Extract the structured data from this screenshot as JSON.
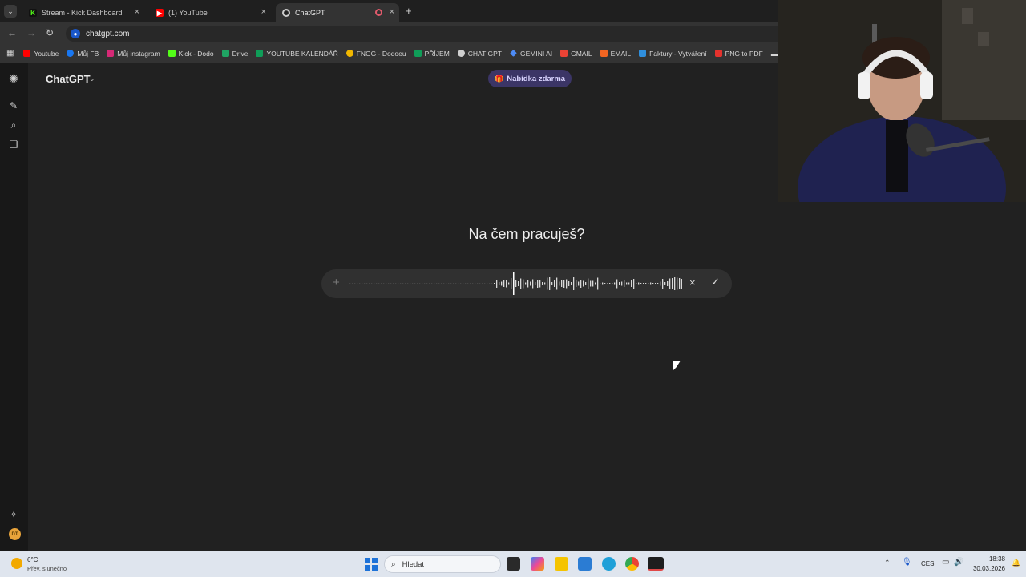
{
  "browser": {
    "tabs": [
      {
        "title": "Stream - Kick Dashboard",
        "favicon": "kick-icon",
        "active": false
      },
      {
        "title": "(1) YouTube",
        "favicon": "youtube-icon",
        "active": false
      },
      {
        "title": "ChatGPT",
        "favicon": "chatgpt-icon",
        "active": true
      }
    ],
    "new_tab": "+",
    "close_glyph": "×",
    "url": "chatgpt.com",
    "bookmarks": [
      {
        "label": "Youtube",
        "color": "#ff0000"
      },
      {
        "label": "Můj FB",
        "color": "#1877f2"
      },
      {
        "label": "Můj instagram",
        "color": "#d62976"
      },
      {
        "label": "Kick - Dodo",
        "color": "#53fc18"
      },
      {
        "label": "Drive",
        "color": "#1fa463"
      },
      {
        "label": "YOUTUBE KALENDÁŘ",
        "color": "#0f9d58"
      },
      {
        "label": "FNGG - Dodoeu",
        "color": "#f2b800"
      },
      {
        "label": "PŘÍJEM",
        "color": "#0f9d58"
      },
      {
        "label": "CHAT GPT",
        "color": "#d0d0d0"
      },
      {
        "label": "GEMINI AI",
        "color": "#4d8bf5"
      },
      {
        "label": "GMAIL",
        "color": "#ea4335"
      },
      {
        "label": "EMAIL",
        "color": "#f26522"
      },
      {
        "label": "Faktury - Vytváření",
        "color": "#2f8fdd"
      },
      {
        "label": "PNG to PDF",
        "color": "#e5322d"
      }
    ]
  },
  "app": {
    "model_name": "ChatGPT",
    "offer_label": "Nabídka zdarma",
    "headline": "Na čem pracuješ?",
    "composer": {
      "plus": "+",
      "cancel": "×",
      "confirm": "✓"
    },
    "avatar_initials": "DT"
  },
  "taskbar": {
    "temperature": "6°C",
    "weather": "Přev. slunečno",
    "search_placeholder": "Hledat",
    "language": "CES",
    "time": "18:38",
    "date": "30.03.2026"
  }
}
